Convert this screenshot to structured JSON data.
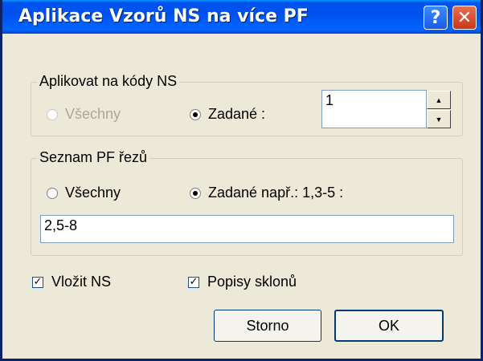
{
  "window": {
    "title": "Aplikace Vzorů NS na více PF"
  },
  "titlebar_buttons": {
    "help": "?",
    "close": "✕"
  },
  "group_codes": {
    "legend": "Aplikovat na kódy NS",
    "radio_all": "Všechny",
    "radio_specified": "Zadané :",
    "input_value": "1"
  },
  "group_sections": {
    "legend": "Seznam PF řezů",
    "radio_all": "Všechny",
    "radio_specified": "Zadané např.: 1,3-5 :",
    "input_value": "2,5-8"
  },
  "checkboxes": {
    "insert_ns": "Vložit NS",
    "slope_labels": "Popisy sklonů"
  },
  "buttons": {
    "cancel": "Storno",
    "ok": "OK"
  },
  "glyphs": {
    "check": "✓",
    "spin_up": "▲",
    "spin_down": "▼"
  }
}
